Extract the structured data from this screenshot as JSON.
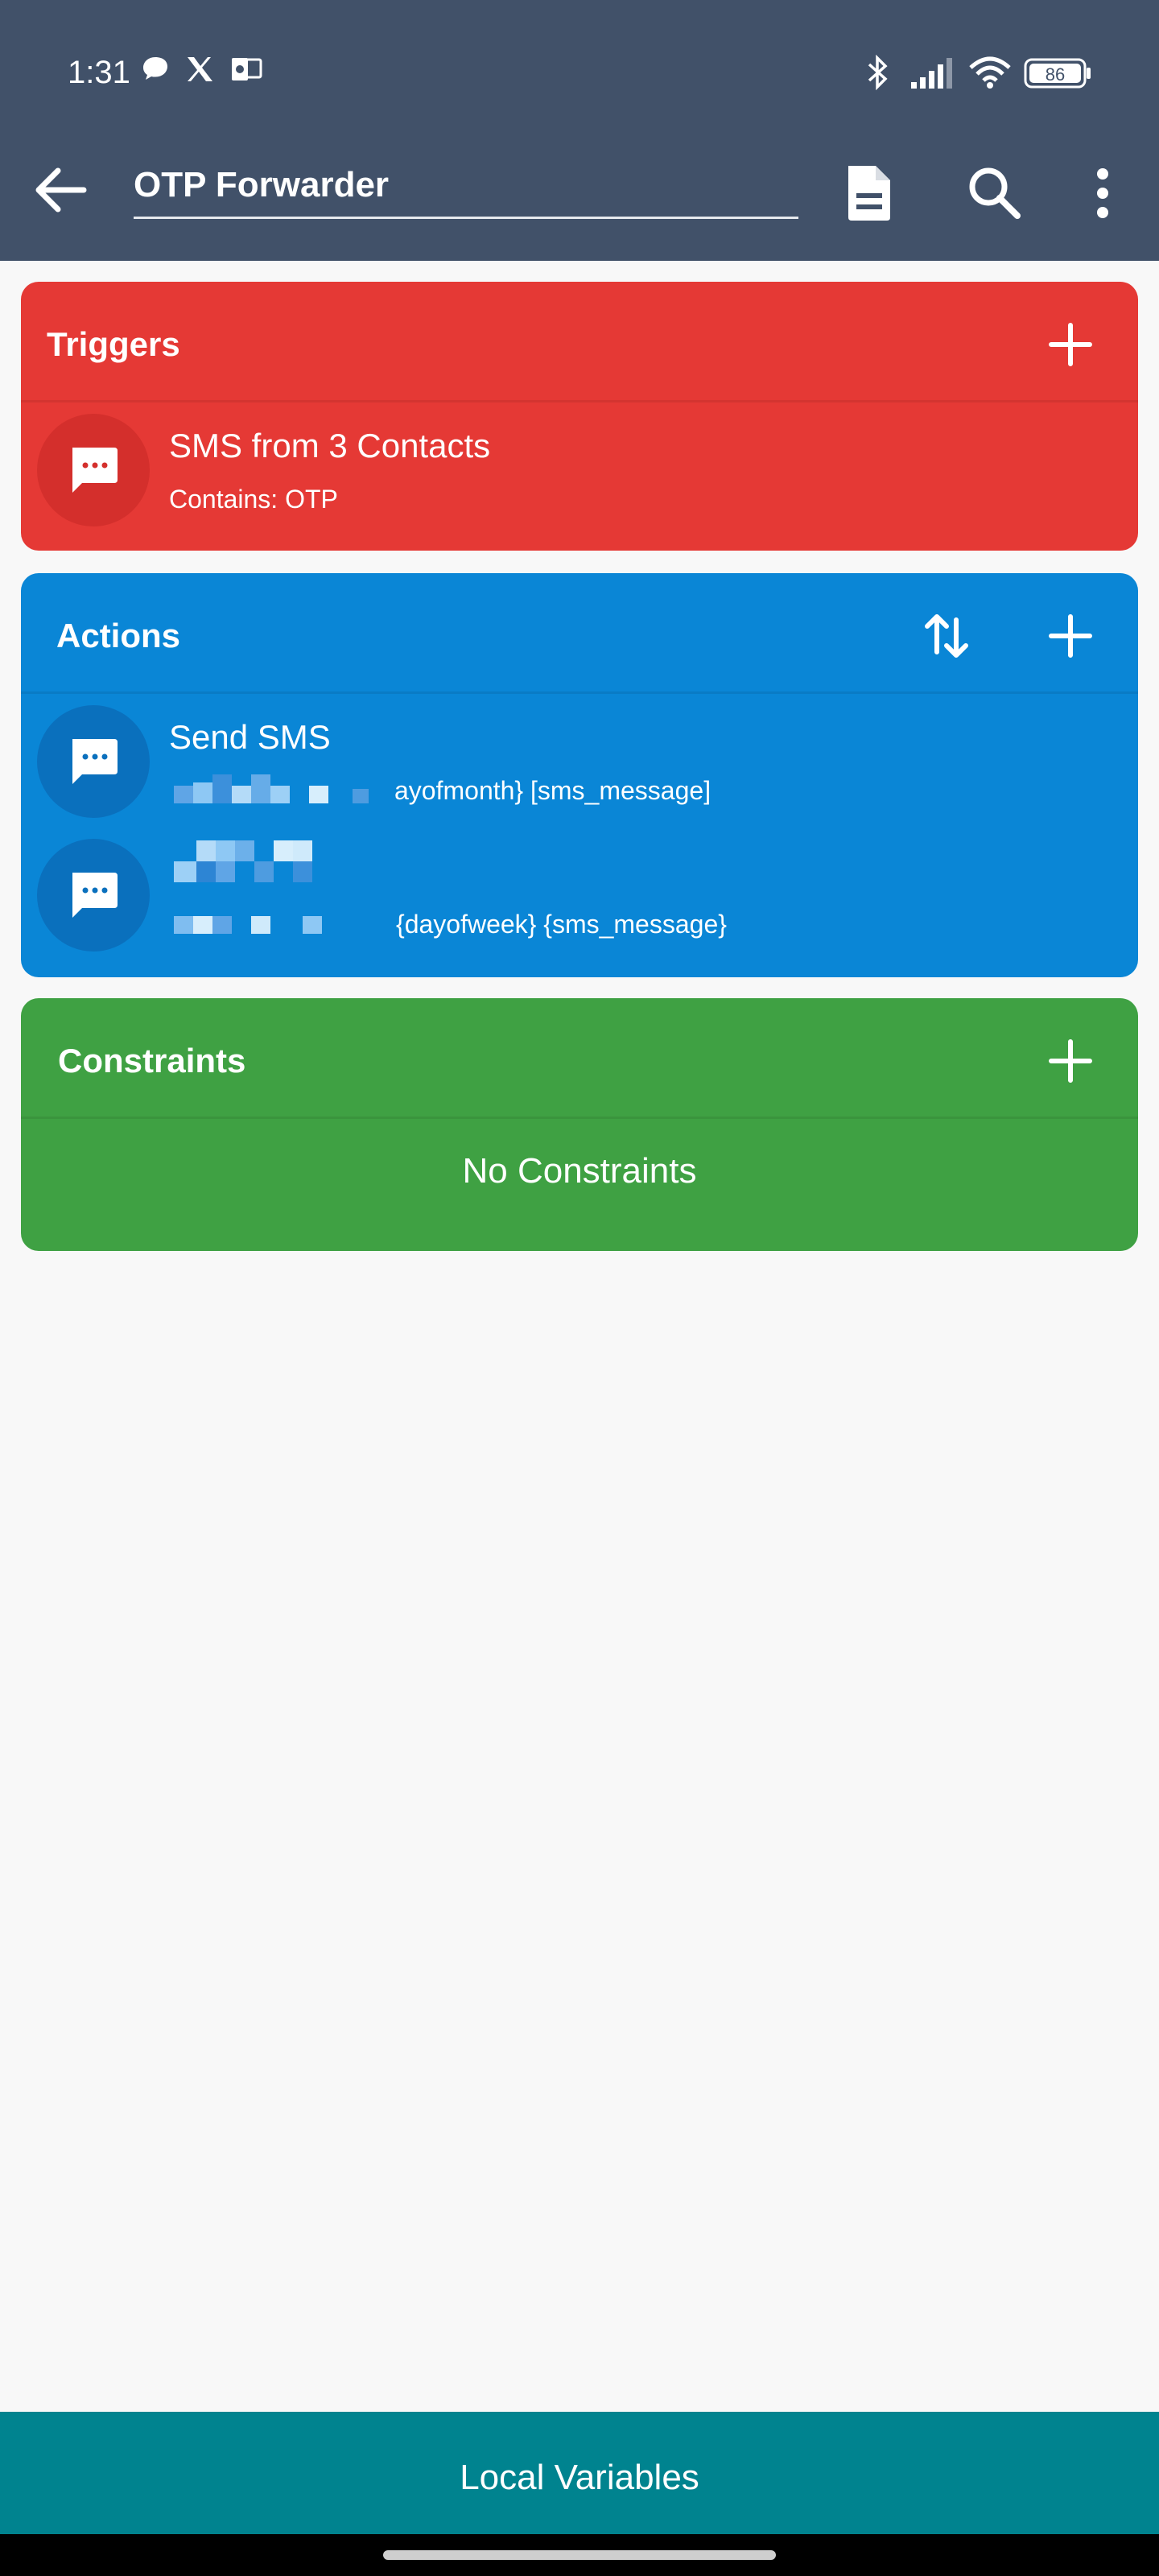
{
  "status_bar": {
    "time": "1:31",
    "battery": "86",
    "icons": [
      "chat-bubble-icon",
      "x-logo-icon",
      "outlook-icon",
      "bluetooth-icon",
      "signal-icon",
      "wifi-icon",
      "battery-icon"
    ]
  },
  "toolbar": {
    "title": "OTP Forwarder",
    "icons": [
      "back-arrow-icon",
      "document-icon",
      "search-icon",
      "more-vert-icon"
    ]
  },
  "triggers": {
    "header": "Triggers",
    "items": [
      {
        "title": "SMS from 3 Contacts",
        "subtitle": "Contains: OTP"
      }
    ]
  },
  "actions": {
    "header": "Actions",
    "items": [
      {
        "title": "Send SMS",
        "subtitle_visible": "ayofmonth} [sms_message]"
      },
      {
        "title": "",
        "subtitle_visible": "{dayofweek} {sms_message}"
      }
    ]
  },
  "constraints": {
    "header": "Constraints",
    "empty_text": "No Constraints"
  },
  "bottom_bar": {
    "label": "Local Variables"
  },
  "colors": {
    "appbar": "#415169",
    "triggers": "#E53935",
    "actions": "#0A86D6",
    "constraints": "#3FA143",
    "bottom_bar": "#00838F",
    "background": "#F8F8F8"
  }
}
